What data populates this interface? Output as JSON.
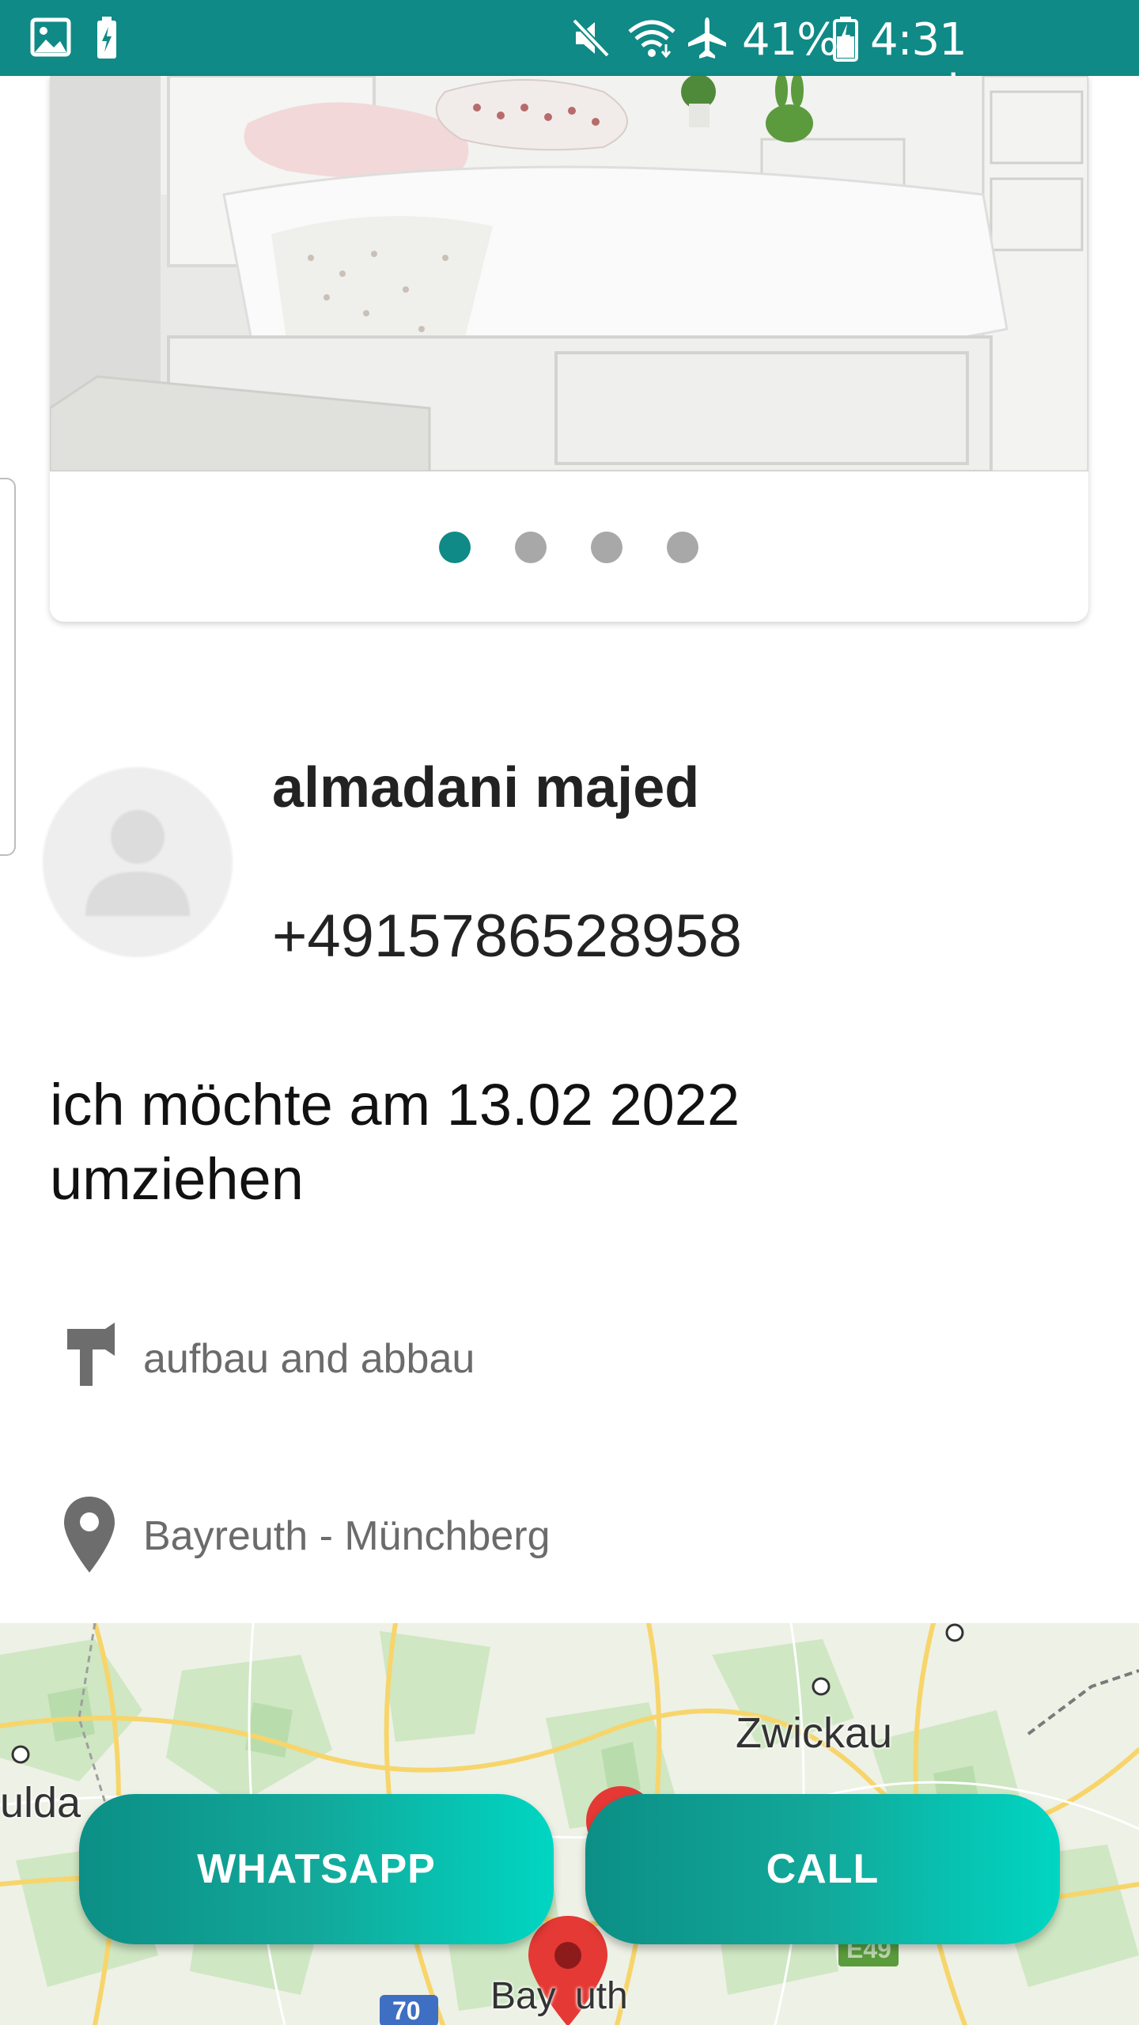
{
  "status_bar": {
    "battery_percent": "41%",
    "time": "4:31 nachm.",
    "icons": [
      "image-icon",
      "battery-saver-icon",
      "mute-icon",
      "wifi-icon",
      "airplane-icon",
      "battery-icon"
    ]
  },
  "gallery": {
    "image": "bed-photo",
    "page_count": 4,
    "active_index": 0
  },
  "profile": {
    "name": "almadani majed",
    "phone": "+4915786528958"
  },
  "message": "ich möchte am 13.02 2022 umziehen",
  "details": {
    "service_label": "aufbau and abbau",
    "service_icon": "hammer-icon",
    "route_label": "Bayreuth - Münchberg",
    "route_icon": "location-pin-icon"
  },
  "map": {
    "labels": {
      "zwickau": "Zwickau",
      "fulda_partial": "ulda",
      "bayreuth_partial_left": "Bay",
      "bayreuth_partial_right": "uth",
      "highway": "70",
      "highway_right": "E49"
    }
  },
  "actions": {
    "whatsapp_label": "WHATSAPP",
    "call_label": "CALL"
  },
  "colors": {
    "primary": "#0f8a86",
    "accent_end": "#00d6c2",
    "marker": "#e53935"
  }
}
